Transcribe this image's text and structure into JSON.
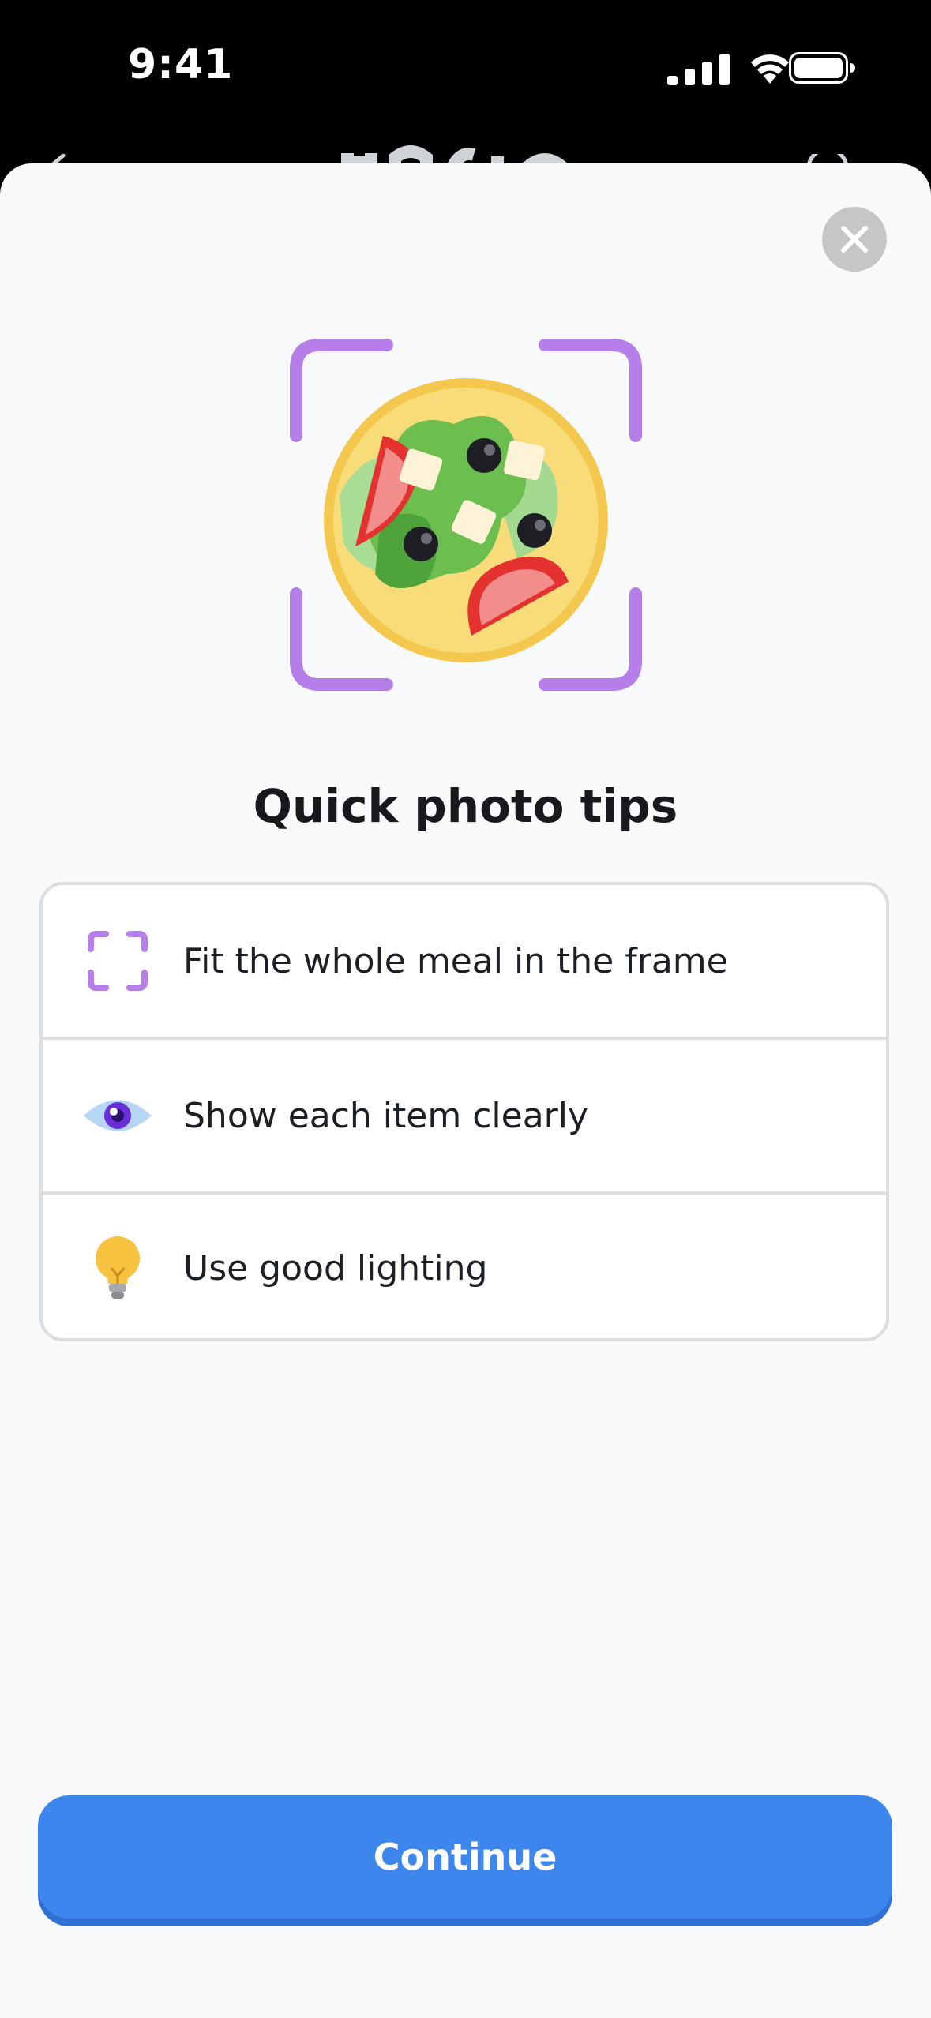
{
  "status_bar": {
    "time": "9:41"
  },
  "sheet": {
    "title": "Quick photo tips",
    "tips": [
      {
        "icon": "frame-corners-icon",
        "label": "Fit the whole meal in the frame"
      },
      {
        "icon": "eye-icon",
        "label": "Show each item clearly"
      },
      {
        "icon": "lightbulb-icon",
        "label": "Use good lighting"
      }
    ],
    "continue_label": "Continue"
  },
  "colors": {
    "accent": "#3d86ee",
    "frame": "#b57ee8",
    "sheet_bg": "#f8f9fb",
    "close_bg": "#c4c6c8"
  }
}
